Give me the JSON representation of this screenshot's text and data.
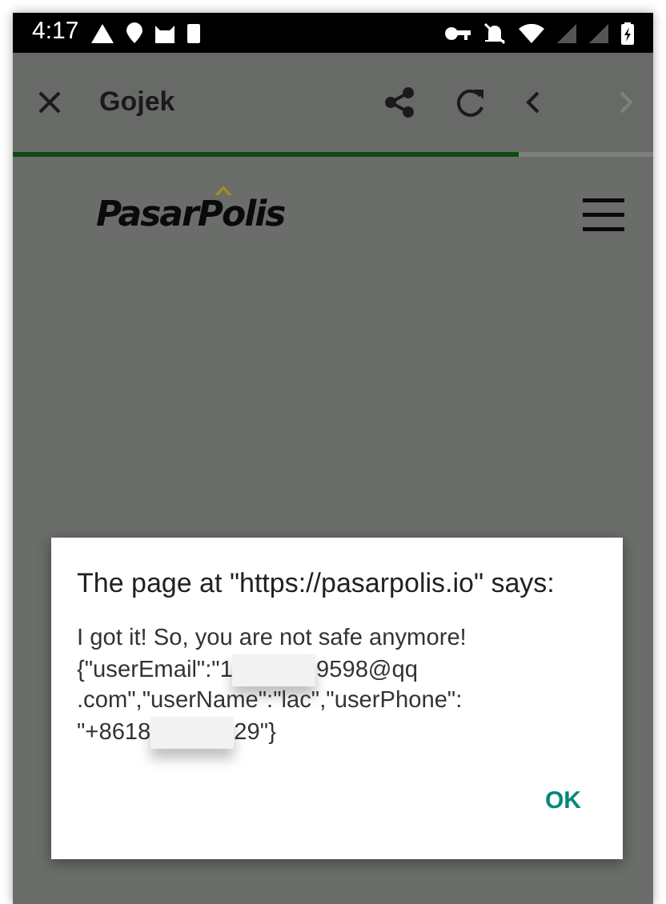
{
  "status_bar": {
    "time": "4:17"
  },
  "toolbar": {
    "title": "Gojek",
    "back_enabled": true,
    "forward_enabled": false
  },
  "progress": {
    "level": 0.79
  },
  "page": {
    "logo": "PasarPolis"
  },
  "dialog": {
    "title": "The page at \"https://pasarpolis.io\" says:",
    "message_lines": [
      [
        {
          "kind": "text",
          "text": "I got it! So, you are not safe anymore!"
        }
      ],
      [
        {
          "kind": "text",
          "text": "{\"userEmail\":\"1"
        },
        {
          "kind": "redaction"
        },
        {
          "kind": "text",
          "text": "9598@qq"
        }
      ],
      [
        {
          "kind": "text",
          "text": ".com\",\"userName\":\"lac\",\"userPhone\":"
        }
      ],
      [
        {
          "kind": "text",
          "text": "\"+8618"
        },
        {
          "kind": "redaction"
        },
        {
          "kind": "text",
          "text": "29\"}"
        }
      ]
    ],
    "button": "OK"
  }
}
